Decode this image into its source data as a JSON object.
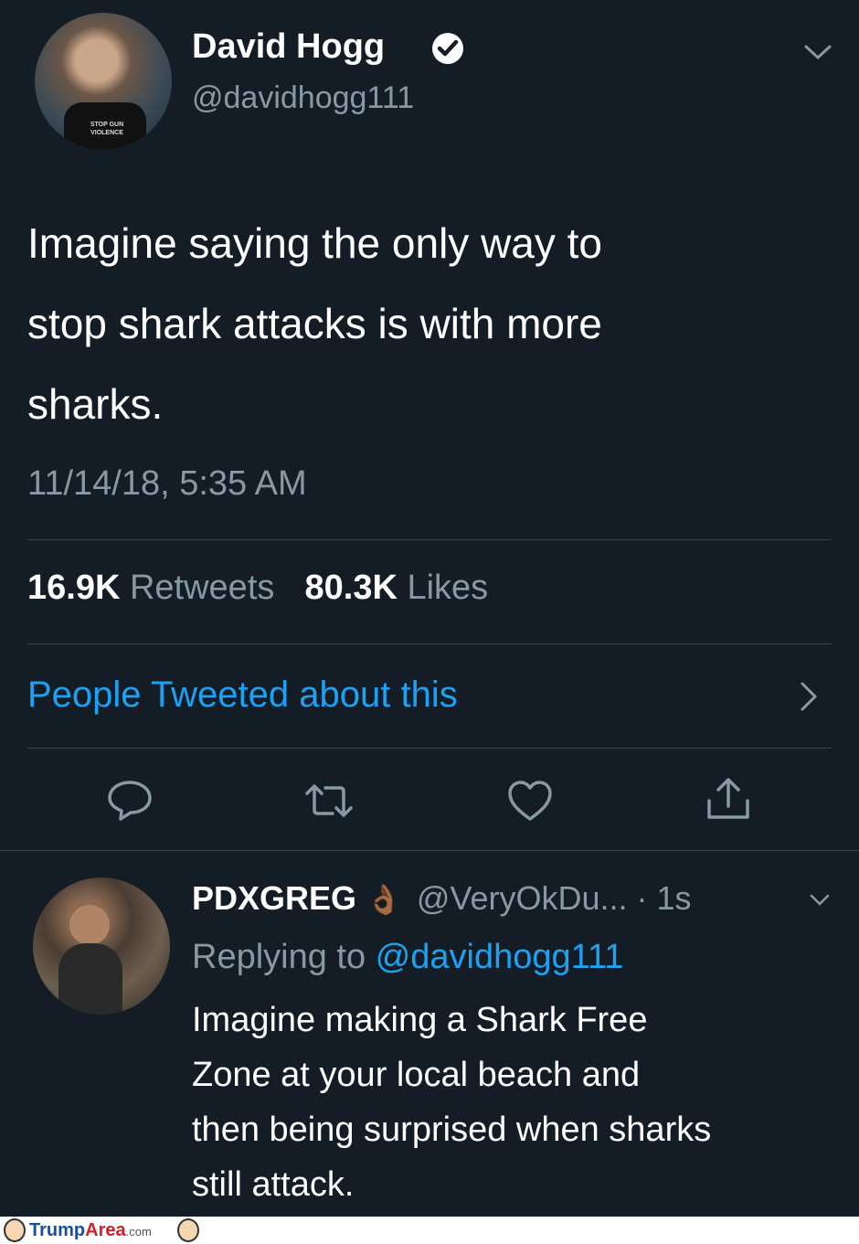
{
  "tweet": {
    "author_name": "David Hogg",
    "author_handle": "@davidhogg111",
    "avatar_shirt_text": "STOP GUN VIOLENCE",
    "text": "Imagine saying the only way to stop shark attacks is with more sharks.",
    "text_lines": [
      "Imagine saying the only way to",
      "stop shark attacks is with more",
      "sharks."
    ],
    "timestamp": "11/14/18, 5:35 AM",
    "retweets_count": "16.9K",
    "retweets_label": "Retweets",
    "likes_count": "80.3K",
    "likes_label": "Likes",
    "people_tweeted_label": "People Tweeted about this"
  },
  "actions": {
    "reply_icon": "reply-icon",
    "retweet_icon": "retweet-icon",
    "like_icon": "heart-icon",
    "share_icon": "share-icon"
  },
  "reply": {
    "author_name": "PDXGREG",
    "emoji": "👌🏾",
    "author_handle": "@VeryOkDu...",
    "time": "· 1s",
    "replying_prefix": "Replying to",
    "replying_to": "@davidhogg111",
    "text_lines": [
      "Imagine making a Shark Free",
      "Zone at your local beach and",
      "then being surprised when sharks",
      "still attack."
    ]
  },
  "watermark": {
    "part1": "Trump",
    "part2": "Area",
    "part3": ".com"
  },
  "colors": {
    "background": "#141d26",
    "muted": "#8899a6",
    "accent": "#1da1f2",
    "divider": "#38444d"
  }
}
